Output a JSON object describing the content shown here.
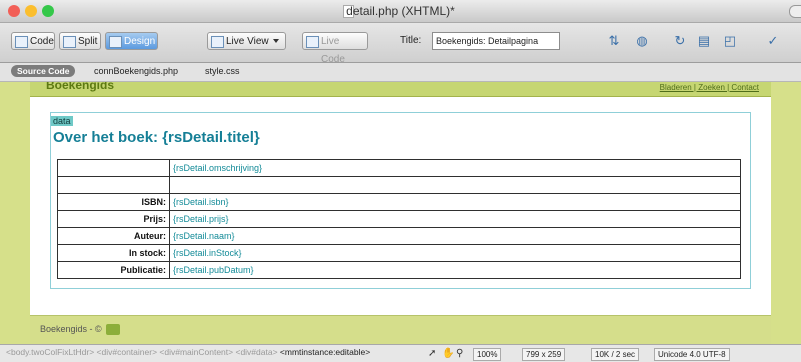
{
  "window": {
    "title": "detail.php (XHTML)*",
    "traffic_light_colors": [
      "#f25f57",
      "#fbbe2e",
      "#35c84a"
    ]
  },
  "toolbar": {
    "code_label": "Code",
    "split_label": "Split",
    "design_label": "Design",
    "live_view_label": "Live View",
    "live_code_label": "Live Code",
    "title_label": "Title:",
    "title_value": "Boekengids: Detailpagina"
  },
  "related_files": [
    "Source Code",
    "connBoekengids.php",
    "style.css"
  ],
  "page": {
    "site_title": "Boekengids",
    "top_nav": "Bladeren | Zoeken | Contact",
    "div_tag": "data",
    "heading": "Over het boek: {rsDetail.titel}",
    "rows": [
      {
        "label": "",
        "value": "{rsDetail.omschrijving}"
      },
      {
        "label": "",
        "value": ""
      },
      {
        "label": "ISBN:",
        "value": "{rsDetail.isbn}"
      },
      {
        "label": "Prijs:",
        "value": "{rsDetail.prijs}"
      },
      {
        "label": "Auteur:",
        "value": "{rsDetail.naam}"
      },
      {
        "label": "In stock:",
        "value": "{rsDetail.inStock}"
      },
      {
        "label": "Publicatie:",
        "value": "{rsDetail.pubDatum}"
      }
    ],
    "footer": "Boekengids - ©"
  },
  "statusbar": {
    "tag_path_prefix": "<body.twoColFixLtHdr> <div#container> <div#mainContent> <div#data>",
    "tag_selected": "<mmtinstance:editable>",
    "zoom": "100%",
    "window_size": "799 x 259",
    "download": "10K / 2 sec",
    "encoding": "Unicode 4.0 UTF-8"
  },
  "colors": {
    "design_background": "#d6e08a",
    "heading": "#157f96",
    "dynamic_text": "#138b98",
    "div_tag": "#6fc9c7"
  }
}
